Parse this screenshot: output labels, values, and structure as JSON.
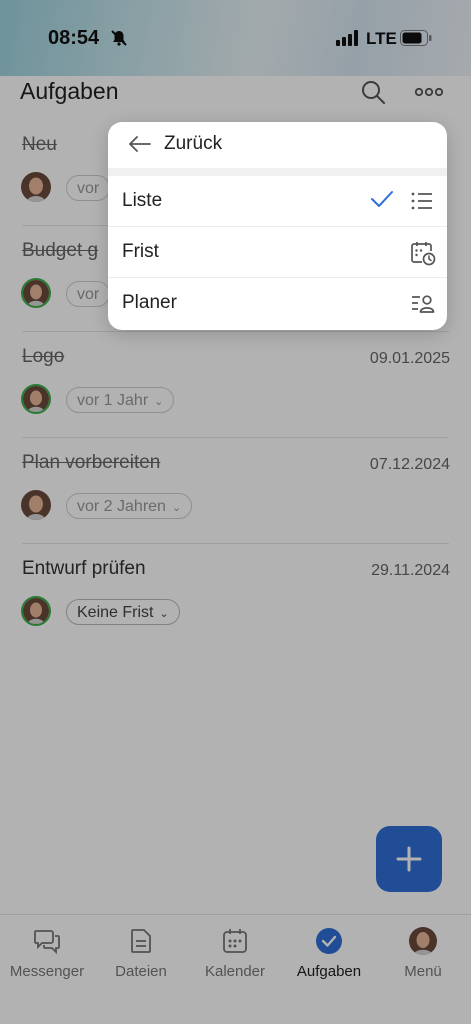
{
  "status_bar": {
    "time": "08:54",
    "network": "LTE"
  },
  "header": {
    "title": "Aufgaben"
  },
  "tasks": [
    {
      "title": "Neu",
      "completed": true,
      "date": "",
      "deadline": "vor"
    },
    {
      "title": "Budget g",
      "completed": true,
      "date": "",
      "deadline": "vor"
    },
    {
      "title": "Logo",
      "completed": true,
      "date": "09.01.2025",
      "deadline": "vor 1 Jahr"
    },
    {
      "title": "Plan vorbereiten",
      "completed": true,
      "date": "07.12.2024",
      "deadline": "vor 2 Jahren"
    },
    {
      "title": "Entwurf prüfen",
      "completed": false,
      "date": "29.11.2024",
      "deadline": "Keine Frist"
    }
  ],
  "fab": {
    "icon": "plus-icon"
  },
  "tab_bar": {
    "items": [
      {
        "label": "Messenger",
        "icon": "chat-bubbles-icon"
      },
      {
        "label": "Dateien",
        "icon": "document-icon"
      },
      {
        "label": "Kalender",
        "icon": "calendar-icon"
      },
      {
        "label": "Aufgaben",
        "icon": "check-circle-icon"
      },
      {
        "label": "Menü",
        "icon": "avatar-icon"
      }
    ],
    "active": "Aufgaben"
  },
  "view_menu": {
    "back_label": "Zurück",
    "options": [
      {
        "label": "Liste",
        "icon": "list-icon",
        "selected": true
      },
      {
        "label": "Frist",
        "icon": "calendar-clock-icon",
        "selected": false
      },
      {
        "label": "Planer",
        "icon": "planner-person-icon",
        "selected": false
      }
    ]
  },
  "colors": {
    "accent": "#2f6fd6",
    "assignee_ring": "#3cb04a",
    "overlay": "rgba(0,0,0,0.30)"
  }
}
